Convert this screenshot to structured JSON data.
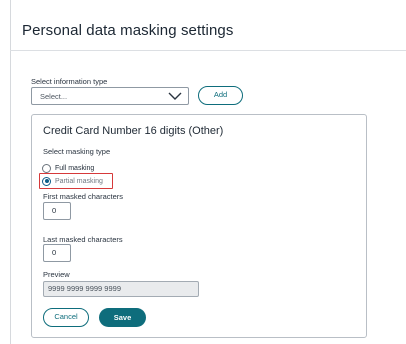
{
  "header": {
    "title": "Personal data masking settings"
  },
  "info_type": {
    "label": "Select information type",
    "select_value": "Select...",
    "add_label": "Add"
  },
  "card": {
    "title": "Credit Card Number 16 digits (Other)",
    "masking_type_label": "Select masking type",
    "options": [
      {
        "label": "Full masking",
        "checked": false
      },
      {
        "label": "Partial masking",
        "checked": true
      }
    ],
    "first_label": "First masked characters",
    "first_value": "0",
    "last_label": "Last masked characters",
    "last_value": "0",
    "preview_label": "Preview",
    "preview_value": "9999 9999 9999 9999",
    "cancel_label": "Cancel",
    "save_label": "Save"
  },
  "colors": {
    "accent": "#0e6d7c",
    "highlight": "#d6393a",
    "radio": "#0e5f8a"
  },
  "icons": {
    "dropdown": "chevron-down-icon"
  }
}
